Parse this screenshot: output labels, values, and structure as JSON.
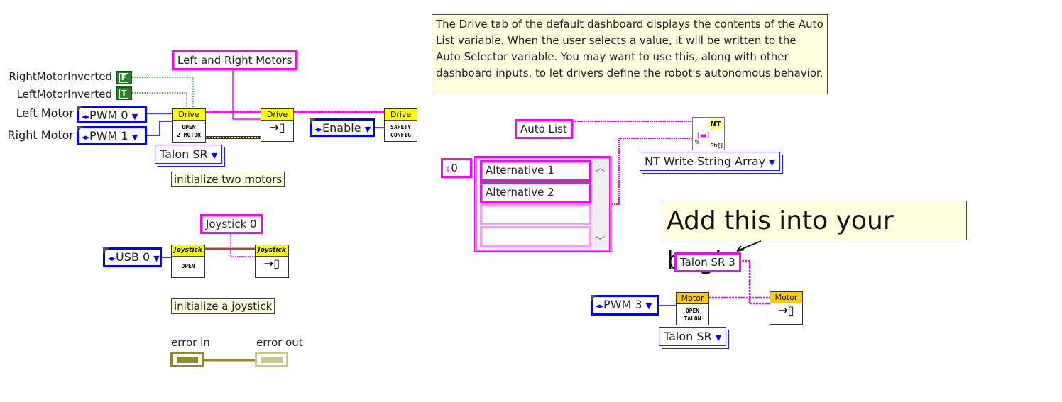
{
  "comment": "The Drive tab of the default dashboard displays the contents of the Auto List variable. When the user selects a value, it will be written to the Auto Selector variable. You may want to use this, along with other dashboard inputs, to let drivers define the robot's autonomous behavior.",
  "drive": {
    "refnum_label": "Left and Right Motors",
    "right_inverted_label": "RightMotorInverted",
    "right_inverted_value": "F",
    "left_inverted_label": "LeftMotorInverted",
    "left_inverted_value": "T",
    "left_motor_label": "Left Motor",
    "left_motor_value": "PWM 0",
    "right_motor_label": "Right Motor",
    "right_motor_value": "PWM 1",
    "open_header": "Drive",
    "open_body1": "OPEN",
    "open_body2": "2 MOTOR",
    "motor_type": "Talon SR",
    "setref_header": "Drive",
    "enable_value": "Enable",
    "safety_header": "Drive",
    "safety_body1": "SAFETY",
    "safety_body2": "CONFIG",
    "comment": "initialize two motors"
  },
  "joystick": {
    "refnum_label": "Joystick 0",
    "usb_value": "USB 0",
    "open_header": "Joystick",
    "open_body": "OPEN",
    "setref_header": "Joystick",
    "comment": "initialize a joystick"
  },
  "error": {
    "in_label": "error in",
    "out_label": "error out"
  },
  "autolist": {
    "label": "Auto List",
    "index": "0",
    "items": [
      "Alternative 1",
      "Alternative 2",
      "",
      ""
    ],
    "nt_badge": "NT",
    "nt_type": "Str[]",
    "nt_select": "NT Write String Array"
  },
  "callout": "Add this into your begin",
  "talon3": {
    "refnum_label": "Talon SR 3",
    "pwm_value": "PWM 3",
    "open_header": "Motor",
    "open_body1": "OPEN",
    "open_body2": "TALON",
    "motor_type": "Talon SR",
    "setref_header": "Motor"
  },
  "colors": {
    "refnum_wire": "#ff00ff",
    "numeric_wire": "#0000ff",
    "bool_wire": "#1a8c1a",
    "error_wire": "#8c8c2c"
  }
}
